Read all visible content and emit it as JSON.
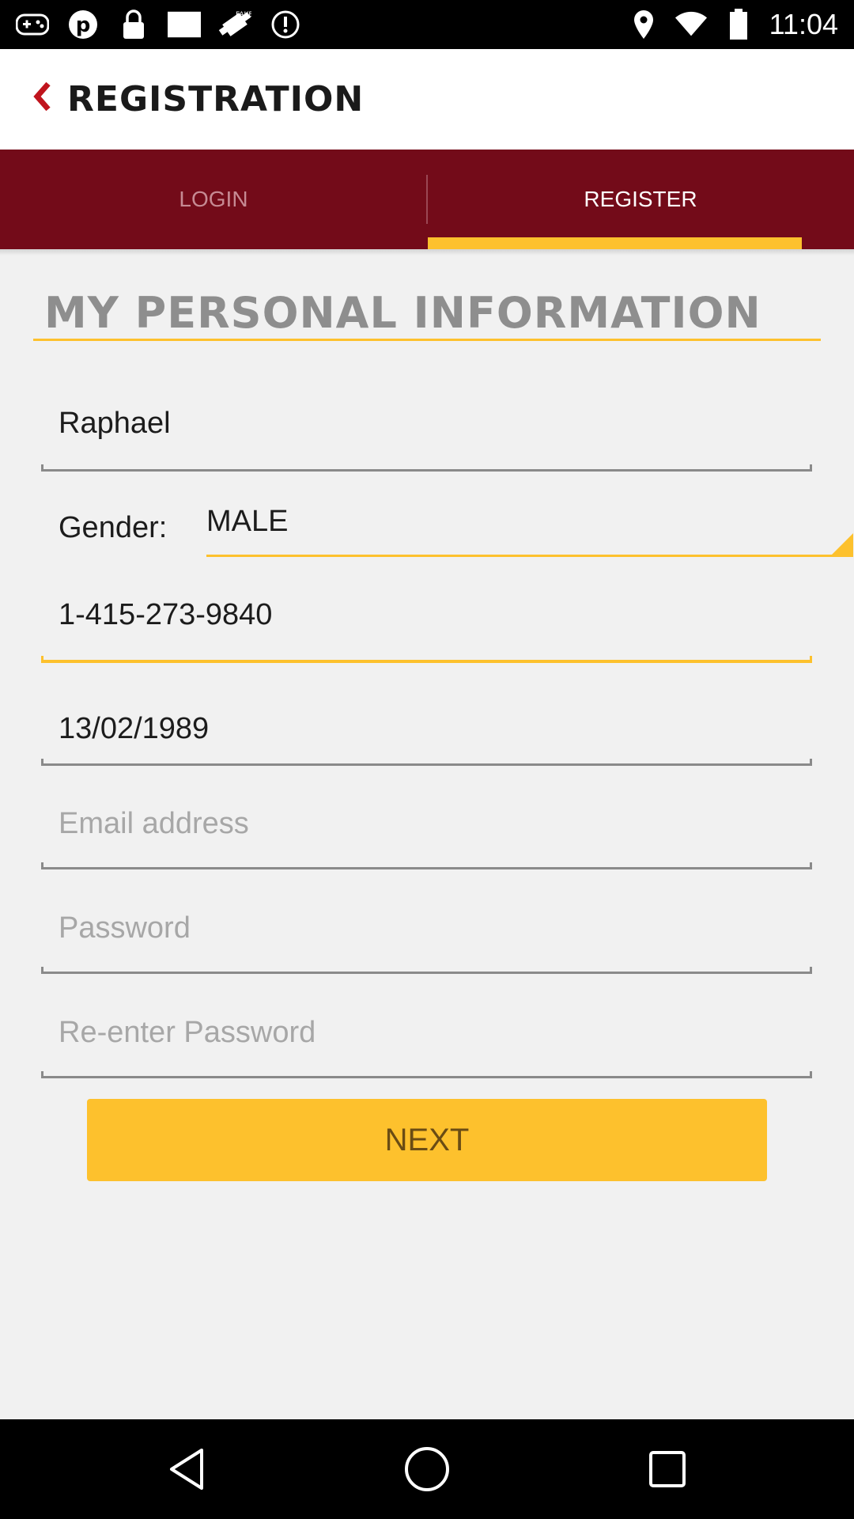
{
  "status_bar": {
    "time": "11:04",
    "left_icons": [
      "gamepad-icon",
      "pinterest-icon",
      "lock-icon",
      "image-icon",
      "fake-gps-icon",
      "update-icon"
    ],
    "right_icons": [
      "location-icon",
      "wifi-icon",
      "battery-icon"
    ]
  },
  "header": {
    "title": "REGISTRATION",
    "back_icon": "chevron-left-icon"
  },
  "tabs": [
    {
      "label": "LOGIN",
      "active": false
    },
    {
      "label": "REGISTER",
      "active": true
    }
  ],
  "section": {
    "title": "MY PERSONAL INFORMATION"
  },
  "form": {
    "name": {
      "value": "Raphael"
    },
    "gender": {
      "label": "Gender:",
      "value": "MALE"
    },
    "phone": {
      "value": "1-415-273-9840"
    },
    "dob": {
      "value": "13/02/1989"
    },
    "email": {
      "placeholder": "Email address"
    },
    "password": {
      "placeholder": "Password"
    },
    "reenter_password": {
      "placeholder": "Re-enter Password"
    },
    "next_label": "NEXT"
  },
  "nav": {
    "back_icon": "back-triangle-icon",
    "home_icon": "home-circle-icon",
    "recents_icon": "recents-square-icon"
  },
  "colors": {
    "tab_bar": "#730b19",
    "accent": "#fdc12d",
    "back_arrow": "#c0141d"
  }
}
